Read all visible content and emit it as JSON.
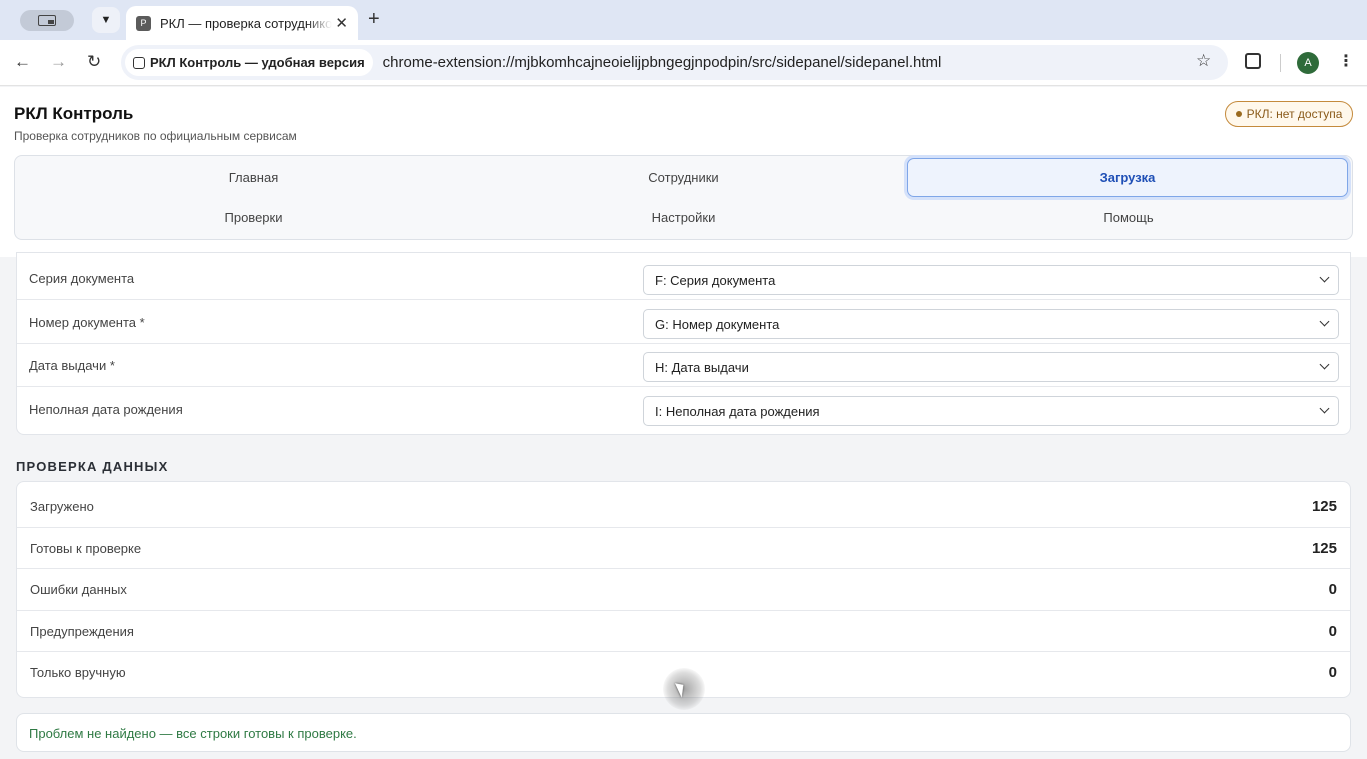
{
  "browser": {
    "tab_title": "РКЛ — проверка сотрудников",
    "favicon_letter": "Р",
    "site_chip": "РКЛ Контроль — удобная версия",
    "url": "chrome-extension://mjbkomhcajneoielijpbngegjnpodpin/src/sidepanel/sidepanel.html",
    "avatar_letter": "A"
  },
  "app": {
    "title": "РКЛ Контроль",
    "subtitle": "Проверка сотрудников по официальным сервисам",
    "status_badge": "РКЛ: нет доступа",
    "tabs": [
      {
        "label": "Главная"
      },
      {
        "label": "Сотрудники"
      },
      {
        "label": "Загрузка",
        "active": true
      },
      {
        "label": "Проверки"
      },
      {
        "label": "Настройки"
      },
      {
        "label": "Помощь"
      }
    ]
  },
  "mapping": {
    "rows": [
      {
        "label": "Серия документа",
        "selected": "F: Серия документа"
      },
      {
        "label": "Номер документа *",
        "selected": "G: Номер документа"
      },
      {
        "label": "Дата выдачи *",
        "selected": "H: Дата выдачи"
      },
      {
        "label": "Неполная дата рождения",
        "selected": "I: Неполная дата рождения"
      }
    ]
  },
  "validation": {
    "title": "ПРОВЕРКА ДАННЫХ",
    "rows": [
      {
        "label": "Загружено",
        "value": "125"
      },
      {
        "label": "Готовы к проверке",
        "value": "125"
      },
      {
        "label": "Ошибки данных",
        "value": "0"
      },
      {
        "label": "Предупреждения",
        "value": "0"
      },
      {
        "label": "Только вручную",
        "value": "0"
      }
    ],
    "result_message": "Проблем не найдено — все строки готовы к проверке."
  },
  "colors": {
    "accent": "#1f4fb6",
    "warning_badge": "#c48a3c",
    "success_text": "#2f7a44"
  }
}
